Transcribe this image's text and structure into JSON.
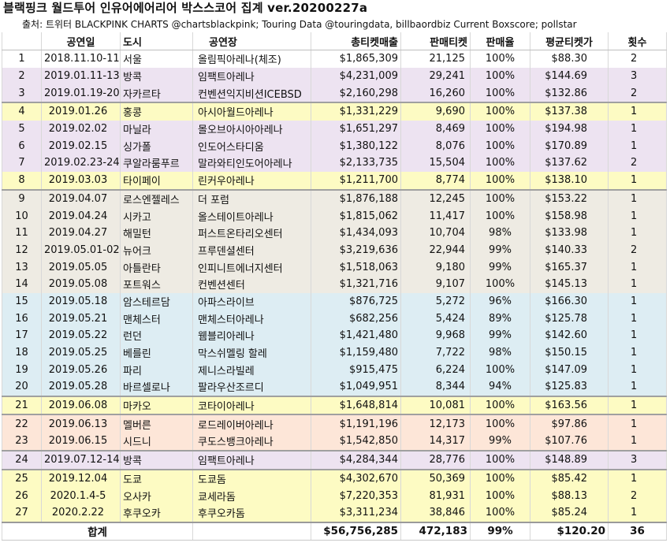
{
  "title": "블랙핑크 월드투어 인유어에어리어 박스스코어 집계 ver.20200227a",
  "source": "출처: 트위터 BLACKPINK CHARTS @chartsblackpink; Touring Data @touringdata, billbaordbiz Current Boxscore; pollstar",
  "headers": [
    "",
    "공연일",
    "도시",
    "공연장",
    "총티켓매출",
    "판매티켓",
    "판매율",
    "평균티켓가",
    "횟수"
  ],
  "colors": {
    "white": "#ffffff",
    "purple": "#ede3f1",
    "yellow": "#fdfbc3",
    "gray": "#eeebe3",
    "blue": "#ddedf3",
    "peach": "#fde6d8"
  },
  "rows": [
    {
      "no": "1",
      "date": "2018.11.10-11",
      "city": "서울",
      "venue": "올림픽아레나(체조)",
      "sales": "$1,865,309",
      "tickets": "21,125",
      "rate": "100%",
      "avg": "$88.30",
      "count": "2",
      "bg": "white"
    },
    {
      "no": "2",
      "date": "2019.01.11-13",
      "city": "방콕",
      "venue": "임팩트아레나",
      "sales": "$4,231,009",
      "tickets": "29,241",
      "rate": "100%",
      "avg": "$144.69",
      "count": "3",
      "bg": "purple"
    },
    {
      "no": "3",
      "date": "2019.01.19-20",
      "city": "자카르타",
      "venue": "컨벤션익지비션ICEBSD",
      "sales": "$2,160,298",
      "tickets": "16,260",
      "rate": "100%",
      "avg": "$132.86",
      "count": "2",
      "bg": "purple"
    },
    {
      "no": "4",
      "date": "2019.01.26",
      "city": "홍콩",
      "venue": "아시아월드아레나",
      "sales": "$1,331,229",
      "tickets": "9,690",
      "rate": "100%",
      "avg": "$137.38",
      "count": "1",
      "bg": "yellow"
    },
    {
      "no": "5",
      "date": "2019.02.02",
      "city": "마닐라",
      "venue": "몰오브아시아아레나",
      "sales": "$1,651,297",
      "tickets": "8,469",
      "rate": "100%",
      "avg": "$194.98",
      "count": "1",
      "bg": "purple"
    },
    {
      "no": "6",
      "date": "2019.02.15",
      "city": "싱가폴",
      "venue": "인도어스타디움",
      "sales": "$1,380,122",
      "tickets": "8,076",
      "rate": "100%",
      "avg": "$170.89",
      "count": "1",
      "bg": "purple"
    },
    {
      "no": "7",
      "date": "2019.02.23-24",
      "city": "쿠알라룸푸르",
      "venue": "말라와티인도어아레나",
      "sales": "$2,133,735",
      "tickets": "15,504",
      "rate": "100%",
      "avg": "$137.62",
      "count": "2",
      "bg": "purple"
    },
    {
      "no": "8",
      "date": "2019.03.03",
      "city": "타이페이",
      "venue": "린커우아레나",
      "sales": "$1,211,700",
      "tickets": "8,774",
      "rate": "100%",
      "avg": "$138.10",
      "count": "1",
      "bg": "yellow"
    },
    {
      "no": "9",
      "date": "2019.04.07",
      "city": "로스엔젤레스",
      "venue": "더 포럼",
      "sales": "$1,876,188",
      "tickets": "12,245",
      "rate": "100%",
      "avg": "$153.22",
      "count": "1",
      "bg": "gray"
    },
    {
      "no": "10",
      "date": "2019.04.24",
      "city": "시카고",
      "venue": "올스테이트아레나",
      "sales": "$1,815,062",
      "tickets": "11,417",
      "rate": "100%",
      "avg": "$158.98",
      "count": "1",
      "bg": "gray"
    },
    {
      "no": "11",
      "date": "2019.04.27",
      "city": "해밀턴",
      "venue": "퍼스트온타리오센터",
      "sales": "$1,434,093",
      "tickets": "10,704",
      "rate": "98%",
      "avg": "$133.98",
      "count": "1",
      "bg": "gray"
    },
    {
      "no": "12",
      "date": "2019.05.01-02",
      "city": "뉴어크",
      "venue": "프루덴셜센터",
      "sales": "$3,219,636",
      "tickets": "22,944",
      "rate": "99%",
      "avg": "$140.33",
      "count": "2",
      "bg": "gray"
    },
    {
      "no": "13",
      "date": "2019.05.05",
      "city": "아틀란타",
      "venue": "인피니트에너지센터",
      "sales": "$1,518,063",
      "tickets": "9,180",
      "rate": "99%",
      "avg": "$165.37",
      "count": "1",
      "bg": "gray"
    },
    {
      "no": "14",
      "date": "2019.05.08",
      "city": "포트워스",
      "venue": "컨벤션센터",
      "sales": "$1,321,716",
      "tickets": "9,107",
      "rate": "100%",
      "avg": "$145.13",
      "count": "1",
      "bg": "gray"
    },
    {
      "no": "15",
      "date": "2019.05.18",
      "city": "암스테르담",
      "venue": "아파스라이브",
      "sales": "$876,725",
      "tickets": "5,272",
      "rate": "96%",
      "avg": "$166.30",
      "count": "1",
      "bg": "blue"
    },
    {
      "no": "16",
      "date": "2019.05.21",
      "city": "맨체스터",
      "venue": "맨체스터아레나",
      "sales": "$682,256",
      "tickets": "5,424",
      "rate": "89%",
      "avg": "$125.78",
      "count": "1",
      "bg": "blue"
    },
    {
      "no": "17",
      "date": "2019.05.22",
      "city": "런던",
      "venue": "웸블리아레나",
      "sales": "$1,421,480",
      "tickets": "9,968",
      "rate": "99%",
      "avg": "$142.60",
      "count": "1",
      "bg": "blue"
    },
    {
      "no": "18",
      "date": "2019.05.25",
      "city": "베를린",
      "venue": "막스쉬멜링 할레",
      "sales": "$1,159,480",
      "tickets": "7,722",
      "rate": "98%",
      "avg": "$150.15",
      "count": "1",
      "bg": "blue"
    },
    {
      "no": "19",
      "date": "2019.05.26",
      "city": "파리",
      "venue": "제니스라빌레",
      "sales": "$915,475",
      "tickets": "6,224",
      "rate": "100%",
      "avg": "$147.09",
      "count": "1",
      "bg": "blue"
    },
    {
      "no": "20",
      "date": "2019.05.28",
      "city": "바르셀로나",
      "venue": "팔라우산조르디",
      "sales": "$1,049,951",
      "tickets": "8,344",
      "rate": "94%",
      "avg": "$125.83",
      "count": "1",
      "bg": "blue"
    },
    {
      "no": "21",
      "date": "2019.06.08",
      "city": "마카오",
      "venue": "코타이아레나",
      "sales": "$1,648,814",
      "tickets": "10,081",
      "rate": "100%",
      "avg": "$163.56",
      "count": "1",
      "bg": "yellow"
    },
    {
      "no": "22",
      "date": "2019.06.13",
      "city": "멜버른",
      "venue": "로드레이버아레나",
      "sales": "$1,191,196",
      "tickets": "12,173",
      "rate": "100%",
      "avg": "$97.86",
      "count": "1",
      "bg": "peach"
    },
    {
      "no": "23",
      "date": "2019.06.15",
      "city": "시드니",
      "venue": "쿠도스뱅크아레나",
      "sales": "$1,542,850",
      "tickets": "14,317",
      "rate": "99%",
      "avg": "$107.76",
      "count": "1",
      "bg": "peach"
    },
    {
      "no": "24",
      "date": "2019.07.12-14",
      "city": "방콕",
      "venue": "임팩트아레나",
      "sales": "$4,284,344",
      "tickets": "28,776",
      "rate": "100%",
      "avg": "$148.89",
      "count": "3",
      "bg": "purple"
    },
    {
      "no": "25",
      "date": "2019.12.04",
      "city": "도쿄",
      "venue": "도쿄돔",
      "sales": "$4,302,670",
      "tickets": "50,369",
      "rate": "100%",
      "avg": "$85.42",
      "count": "1",
      "bg": "yellow"
    },
    {
      "no": "26",
      "date": "2020.1.4-5",
      "city": "오사카",
      "venue": "쿄세라돔",
      "sales": "$7,220,353",
      "tickets": "81,931",
      "rate": "100%",
      "avg": "$88.13",
      "count": "2",
      "bg": "yellow"
    },
    {
      "no": "27",
      "date": "2020.2.22",
      "city": "후쿠오카",
      "venue": "후쿠오카돔",
      "sales": "$3,311,234",
      "tickets": "38,846",
      "rate": "100%",
      "avg": "$85.24",
      "count": "1",
      "bg": "yellow"
    }
  ],
  "total": {
    "label": "합계",
    "sales": "$56,756,285",
    "tickets": "472,183",
    "rate": "99%",
    "avg": "$120.20",
    "count": "36"
  }
}
